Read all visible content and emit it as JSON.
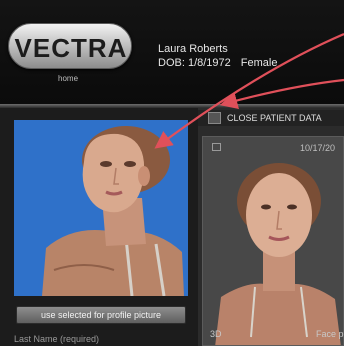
{
  "header": {
    "logo_text": "VECTRA",
    "home_label": "home",
    "patient_name": "Laura Roberts",
    "dob_label": "DOB: 1/8/1972",
    "gender": "Female"
  },
  "patient_bar": {
    "close_label": "CLOSE PATIENT DATA",
    "icon": "collapse-window-icon"
  },
  "profile": {
    "use_button_label": "use selected for profile picture",
    "last_name_label": "Last Name (required)"
  },
  "capture_card": {
    "date": "10/17/20",
    "type_label": "3D",
    "view_label": "Face p"
  },
  "colors": {
    "photo_bg": "#2f71c9",
    "annotation_arrow": "#e0505a",
    "header_bg": "#141414"
  }
}
